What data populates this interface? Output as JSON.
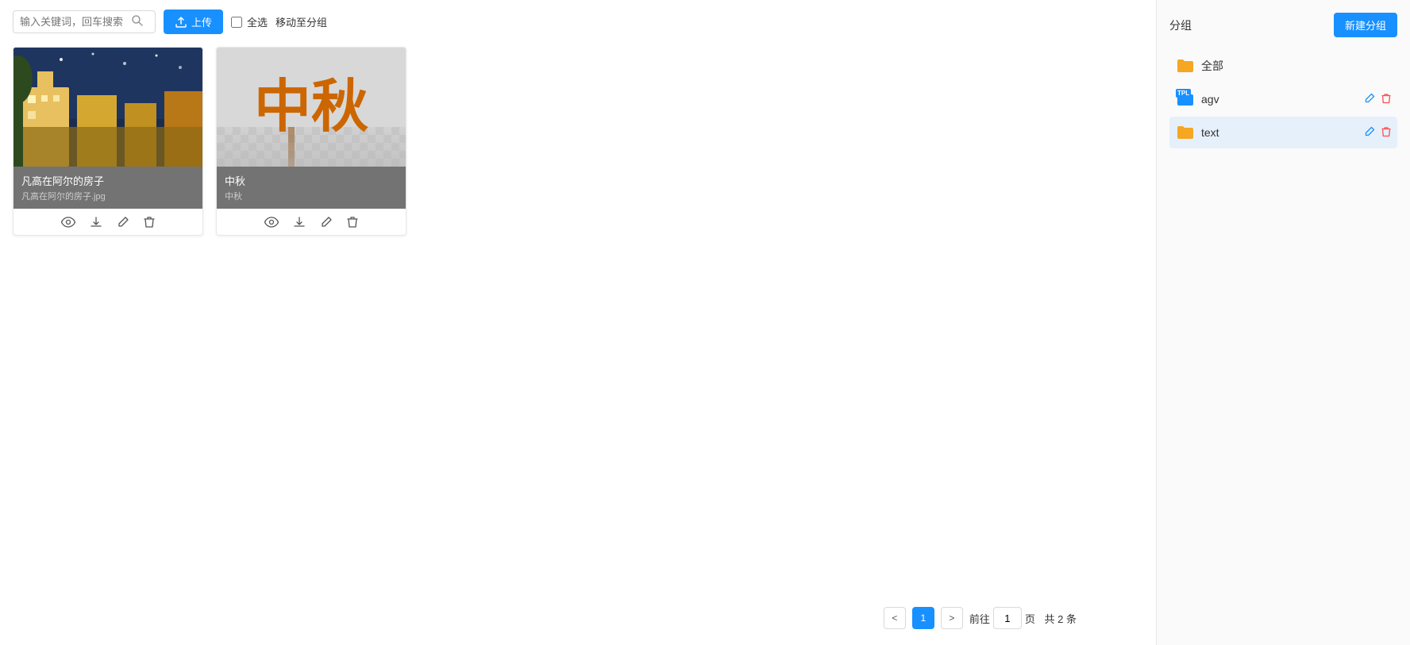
{
  "toolbar": {
    "search_placeholder": "输入关键词，回车搜索",
    "upload_label": "上传",
    "select_all_label": "全选",
    "move_to_group_label": "移动至分组"
  },
  "images": [
    {
      "id": "img1",
      "name": "凡高在阿尔的房子",
      "filename": "凡高在阿尔的房子.jpg",
      "type": "painting"
    },
    {
      "id": "img2",
      "name": "中秋",
      "filename": "中秋",
      "type": "text",
      "display_text": "中秋"
    }
  ],
  "pagination": {
    "prev_label": "<",
    "next_label": ">",
    "current_page": "1",
    "page_prefix": "前往",
    "page_suffix": "页",
    "total_label": "共 2 条"
  },
  "sidebar": {
    "title": "分组",
    "new_group_label": "新建分组",
    "groups": [
      {
        "id": "all",
        "name": "全部",
        "icon_type": "folder_yellow",
        "active": false
      },
      {
        "id": "agv",
        "name": "agv",
        "icon_type": "folder_blue_tpl",
        "active": false
      },
      {
        "id": "text",
        "name": "text",
        "icon_type": "folder_yellow",
        "active": true
      }
    ]
  }
}
